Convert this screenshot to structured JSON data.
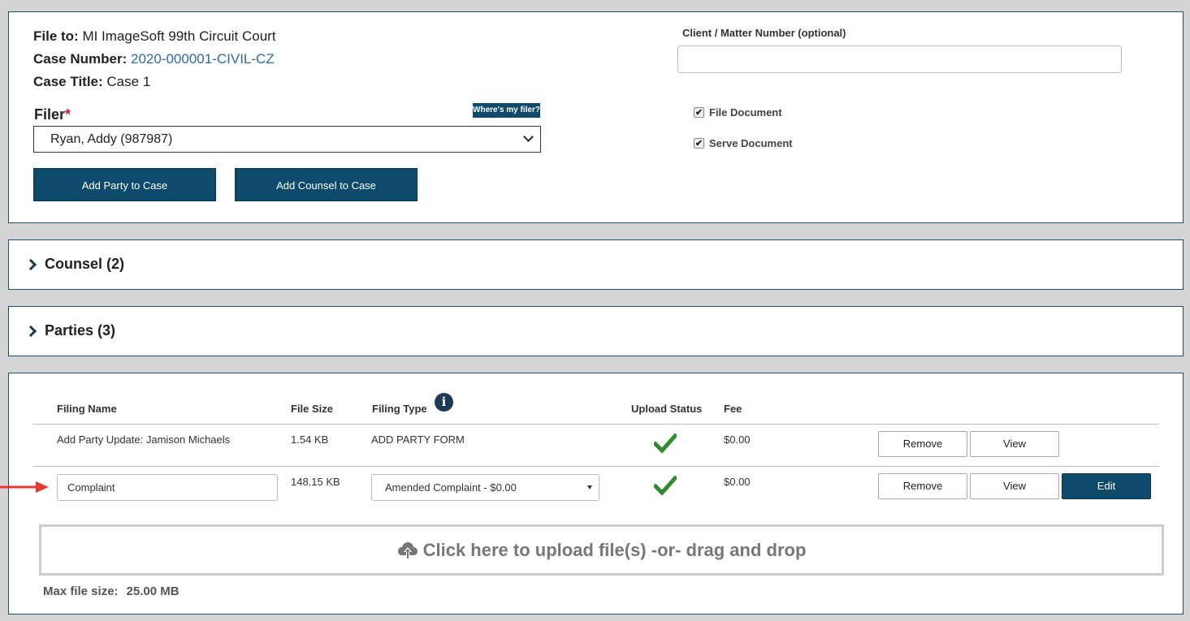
{
  "case": {
    "file_to_label": "File to:",
    "file_to_value": "MI ImageSoft 99th Circuit Court",
    "case_number_label": "Case Number:",
    "case_number_value": "2020-000001-CIVIL-CZ",
    "case_title_label": "Case Title:",
    "case_title_value": "Case 1"
  },
  "filer": {
    "label": "Filer",
    "required_mark": "*",
    "help_button": "Where's my filer?",
    "selected": "Ryan, Addy (987987)"
  },
  "buttons": {
    "add_party": "Add Party to Case",
    "add_counsel": "Add Counsel to Case"
  },
  "client_matter": {
    "label": "Client / Matter Number (optional)",
    "value": ""
  },
  "options": {
    "file_document": "File Document",
    "serve_document": "Serve Document",
    "file_document_checked": true,
    "serve_document_checked": true
  },
  "sections": {
    "counsel": "Counsel (2)",
    "parties": "Parties (3)"
  },
  "files_table": {
    "headers": {
      "filing_name": "Filing Name",
      "file_size": "File Size",
      "filing_type": "Filing Type",
      "upload_status": "Upload Status",
      "fee": "Fee"
    },
    "rows": [
      {
        "filing_name": "Add Party Update: Jamison Michaels",
        "file_size": "1.54 KB",
        "filing_type": "ADD PARTY FORM",
        "upload_status": "check-icon",
        "fee": "$0.00",
        "remove": "Remove",
        "view": "View"
      },
      {
        "filing_name": "Complaint",
        "file_size": "148.15 KB",
        "filing_type": "Amended Complaint - $0.00",
        "upload_status": "check-icon",
        "fee": "$0.00",
        "remove": "Remove",
        "view": "View",
        "edit": "Edit"
      }
    ]
  },
  "upload": {
    "text": "Click here to upload file(s) -or- drag and drop",
    "max_label": "Max file size:",
    "max_value": "25.00 MB"
  },
  "colors": {
    "primary": "#0d4a6b",
    "link": "#2f6c9b",
    "success": "#2e8b2e",
    "arrow": "#e53935",
    "required": "#c1272d"
  }
}
